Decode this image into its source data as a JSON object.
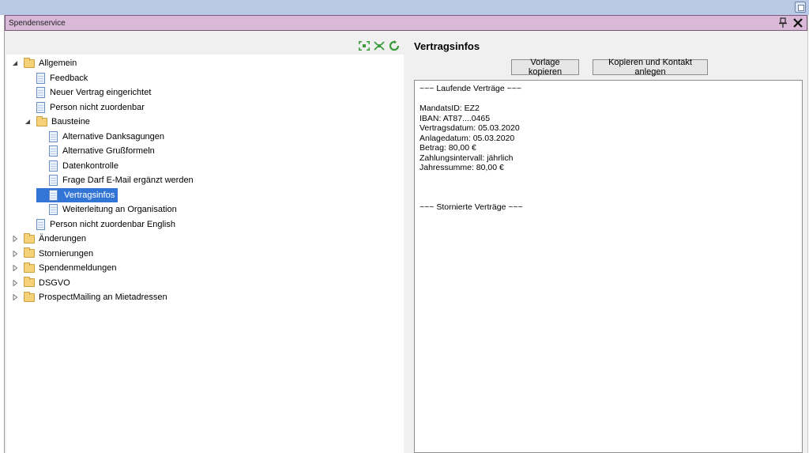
{
  "window": {
    "title": "Spendenservice"
  },
  "tree": {
    "items": [
      {
        "label": "Allgemein",
        "type": "folder",
        "expanded": true,
        "level": 0
      },
      {
        "label": "Feedback",
        "type": "doc",
        "level": 1
      },
      {
        "label": "Neuer Vertrag eingerichtet",
        "type": "doc",
        "level": 1
      },
      {
        "label": "Person nicht zuordenbar",
        "type": "doc",
        "level": 1
      },
      {
        "label": "Bausteine",
        "type": "folder",
        "expanded": true,
        "level": 1
      },
      {
        "label": "Alternative Danksagungen",
        "type": "doc",
        "level": 2
      },
      {
        "label": "Alternative Grußformeln",
        "type": "doc",
        "level": 2
      },
      {
        "label": "Datenkontrolle",
        "type": "doc",
        "level": 2
      },
      {
        "label": "Frage Darf E-Mail ergänzt werden",
        "type": "doc",
        "level": 2
      },
      {
        "label": "Vertragsinfos",
        "type": "doc",
        "level": 2,
        "selected": true
      },
      {
        "label": "Weiterleitung an Organisation",
        "type": "doc",
        "level": 2
      },
      {
        "label": "Person nicht zuordenbar English",
        "type": "doc",
        "level": 1
      },
      {
        "label": "Änderungen",
        "type": "folder",
        "expanded": false,
        "level": 0
      },
      {
        "label": "Stornierungen",
        "type": "folder",
        "expanded": false,
        "level": 0
      },
      {
        "label": "Spendenmeldungen",
        "type": "folder",
        "expanded": false,
        "level": 0
      },
      {
        "label": "DSGVO",
        "type": "folder",
        "expanded": false,
        "level": 0
      },
      {
        "label": "ProspectMailing an Mietadressen",
        "type": "folder",
        "expanded": false,
        "level": 0
      }
    ]
  },
  "details": {
    "title": "Vertragsinfos",
    "buttons": {
      "copy_template": "Vorlage kopieren",
      "copy_and_create_contact": "Kopieren und Kontakt anlegen"
    },
    "content_lines": [
      "~~~ Laufende Verträge ~~~",
      "",
      "MandatsID: EZ2",
      "IBAN: AT87....0465",
      "Vertragsdatum: 05.03.2020",
      "Anlagedatum: 05.03.2020",
      "Betrag: 80,00 €",
      "Zahlungsintervall: jährlich",
      "Jahressumme: 80,00 €",
      "",
      "",
      "",
      "~~~ Stornierte Verträge ~~~"
    ]
  },
  "colors": {
    "titlebar": "#d9b8d8",
    "selection": "#3375d6",
    "top_strip": "#b9c9e6"
  }
}
